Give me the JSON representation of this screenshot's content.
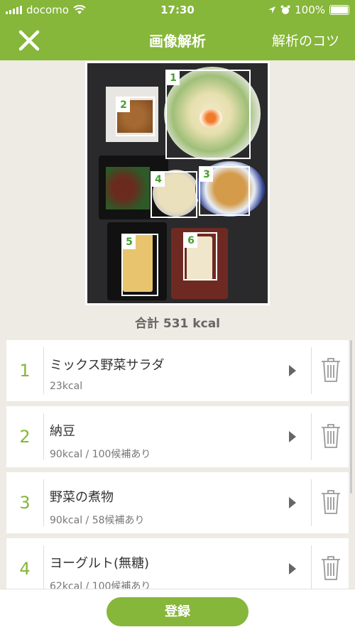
{
  "status_bar": {
    "carrier": "docomo",
    "time": "17:30",
    "battery": "100%"
  },
  "nav": {
    "title": "画像解析",
    "tips_label": "解析のコツ"
  },
  "photo_labels": [
    "1",
    "2",
    "3",
    "4",
    "5",
    "6"
  ],
  "total": "合計 531 kcal",
  "items": [
    {
      "index": "1",
      "name": "ミックス野菜サラダ",
      "detail": "23kcal"
    },
    {
      "index": "2",
      "name": "納豆",
      "detail": "90kcal / 100候補あり"
    },
    {
      "index": "3",
      "name": "野菜の煮物",
      "detail": "90kcal / 58候補あり"
    },
    {
      "index": "4",
      "name": "ヨーグルト(無糖)",
      "detail": "62kcal / 100候補あり"
    }
  ],
  "footer": {
    "register_label": "登録"
  },
  "colors": {
    "accent": "#86b63a",
    "label_green": "#46a030",
    "background": "#eeebe4"
  }
}
